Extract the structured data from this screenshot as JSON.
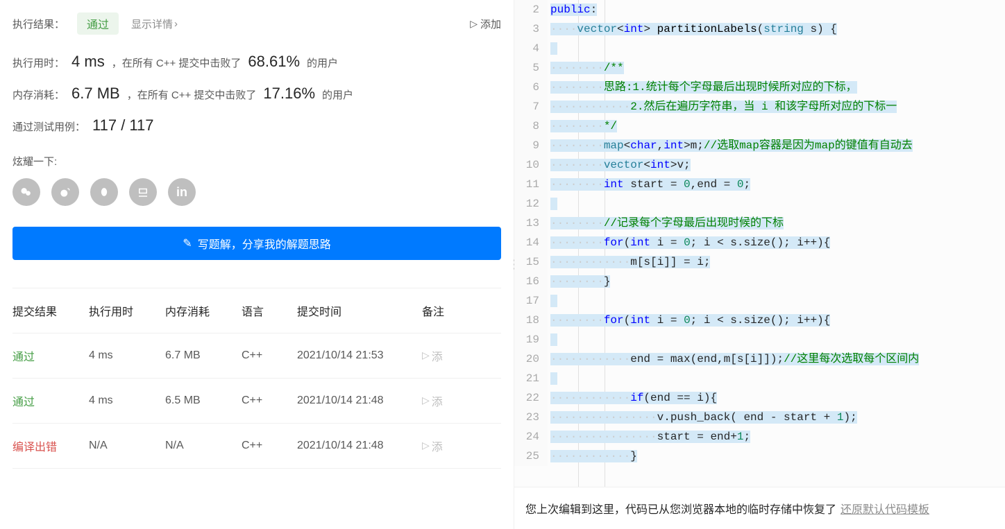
{
  "result": {
    "label": "执行结果：",
    "status": "通过",
    "show_details": "显示详情",
    "add_note": "添加"
  },
  "runtime": {
    "label": "执行用时：",
    "value": "4 ms",
    "beat_prefix": "，在所有 C++ 提交中击败了",
    "pct": "68.61%",
    "suffix": "的用户"
  },
  "memory": {
    "label": "内存消耗：",
    "value": "6.7 MB",
    "beat_prefix": "，在所有 C++ 提交中击败了",
    "pct": "17.16%",
    "suffix": "的用户"
  },
  "testcases": {
    "label": "通过测试用例：",
    "value": "117 / 117"
  },
  "brag": {
    "label": "炫耀一下:"
  },
  "solution_btn": "写题解，分享我的解题思路",
  "history": {
    "headers": {
      "result": "提交结果",
      "runtime": "执行用时",
      "memory": "内存消耗",
      "lang": "语言",
      "time": "提交时间",
      "note": "备注"
    },
    "note_add": "添",
    "rows": [
      {
        "status": "通过",
        "status_class": "passed",
        "runtime": "4 ms",
        "memory": "6.7 MB",
        "lang": "C++",
        "time": "2021/10/14 21:53"
      },
      {
        "status": "通过",
        "status_class": "passed",
        "runtime": "4 ms",
        "memory": "6.5 MB",
        "lang": "C++",
        "time": "2021/10/14 21:48"
      },
      {
        "status": "编译出错",
        "status_class": "error",
        "runtime": "N/A",
        "memory": "N/A",
        "lang": "C++",
        "time": "2021/10/14 21:48"
      }
    ]
  },
  "code": {
    "lines": [
      {
        "n": 2,
        "hl": true,
        "html": "<span class='kw'>public</span>:"
      },
      {
        "n": 3,
        "hl": true,
        "html": "    <span class='type'>vector</span>&lt;<span class='kw'>int</span>&gt; <span class='fn'>partitionLabels</span>(<span class='type'>string</span> s) {"
      },
      {
        "n": 4,
        "hl": true,
        "html": ""
      },
      {
        "n": 5,
        "hl": true,
        "html": "        <span class='cm'>/**</span>"
      },
      {
        "n": 6,
        "hl": true,
        "html": "        <span class='cm'>思路:1.统计每个字母最后出现时候所对应的下标，</span>"
      },
      {
        "n": 7,
        "hl": true,
        "html": "            <span class='cm'>2.然后在遍历字符串，当 i 和该字母所对应的下标一</span>"
      },
      {
        "n": 8,
        "hl": true,
        "html": "        <span class='cm'>*/</span>"
      },
      {
        "n": 9,
        "hl": true,
        "html": "        <span class='type'>map</span>&lt;<span class='kw'>char</span>,<span class='kw'>int</span>&gt;m;<span class='cm'>//选取map容器是因为map的键值有自动去</span>"
      },
      {
        "n": 10,
        "hl": true,
        "html": "        <span class='type'>vector</span>&lt;<span class='kw'>int</span>&gt;v;"
      },
      {
        "n": 11,
        "hl": true,
        "html": "        <span class='kw'>int</span> start = <span class='num'>0</span>,end = <span class='num'>0</span>;"
      },
      {
        "n": 12,
        "hl": true,
        "html": ""
      },
      {
        "n": 13,
        "hl": true,
        "html": "        <span class='cm'>//记录每个字母最后出现时候的下标</span>"
      },
      {
        "n": 14,
        "hl": true,
        "html": "        <span class='kw'>for</span>(<span class='kw'>int</span> i = <span class='num'>0</span>; i &lt; s.size(); i++){"
      },
      {
        "n": 15,
        "hl": true,
        "html": "            m[s[i]] = i;"
      },
      {
        "n": 16,
        "hl": true,
        "html": "        }"
      },
      {
        "n": 17,
        "hl": true,
        "html": ""
      },
      {
        "n": 18,
        "hl": true,
        "html": "        <span class='kw'>for</span>(<span class='kw'>int</span> i = <span class='num'>0</span>; i &lt; s.size(); i++){"
      },
      {
        "n": 19,
        "hl": true,
        "html": ""
      },
      {
        "n": 20,
        "hl": true,
        "html": "            end = max(end,m[s[i]]);<span class='cm'>//这里每次选取每个区间内</span>"
      },
      {
        "n": 21,
        "hl": true,
        "html": ""
      },
      {
        "n": 22,
        "hl": true,
        "html": "            <span class='kw'>if</span>(end == i){"
      },
      {
        "n": 23,
        "hl": true,
        "html": "                v.push_back( end - start + <span class='num'>1</span>);"
      },
      {
        "n": 24,
        "hl": true,
        "html": "                start = end+<span class='num'>1</span>;"
      },
      {
        "n": 25,
        "hl": true,
        "html": "            }"
      }
    ]
  },
  "restore": {
    "text": "您上次编辑到这里，代码已从您浏览器本地的临时存储中恢复了",
    "link": "还原默认代码模板"
  }
}
